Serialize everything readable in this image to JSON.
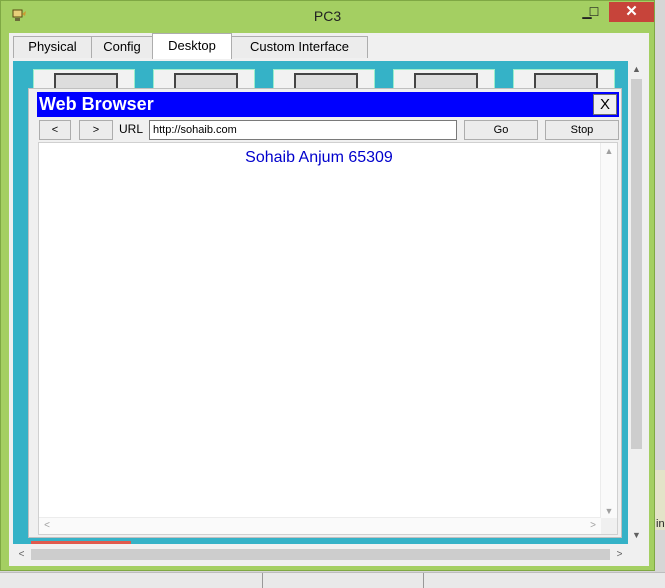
{
  "window": {
    "title": "PC3",
    "minimize_glyph": "▁",
    "maximize_glyph": "☐",
    "close_glyph": "✕"
  },
  "tabs": [
    {
      "label": "Physical"
    },
    {
      "label": "Config"
    },
    {
      "label": "Desktop",
      "active": true
    },
    {
      "label": "Custom Interface"
    }
  ],
  "browser": {
    "title": "Web Browser",
    "close_label": "X",
    "back_label": "<",
    "forward_label": ">",
    "url_label": "URL",
    "url_value": "http://sohaib.com",
    "go_label": "Go",
    "stop_label": "Stop",
    "page_text": "Sohaib Anjum 65309"
  },
  "scroll": {
    "up": "▲",
    "down": "▼",
    "left": "<",
    "right": ">"
  },
  "background": {
    "right_edge_letter": "in"
  },
  "colors": {
    "window_frame": "#a4cf62",
    "close_button": "#c7443a",
    "browser_header": "#0000ff",
    "page_text": "#0000cc",
    "desktop_bg": "#35b2c7"
  },
  "icons": {
    "app": "packet-tracer-pc-icon"
  }
}
